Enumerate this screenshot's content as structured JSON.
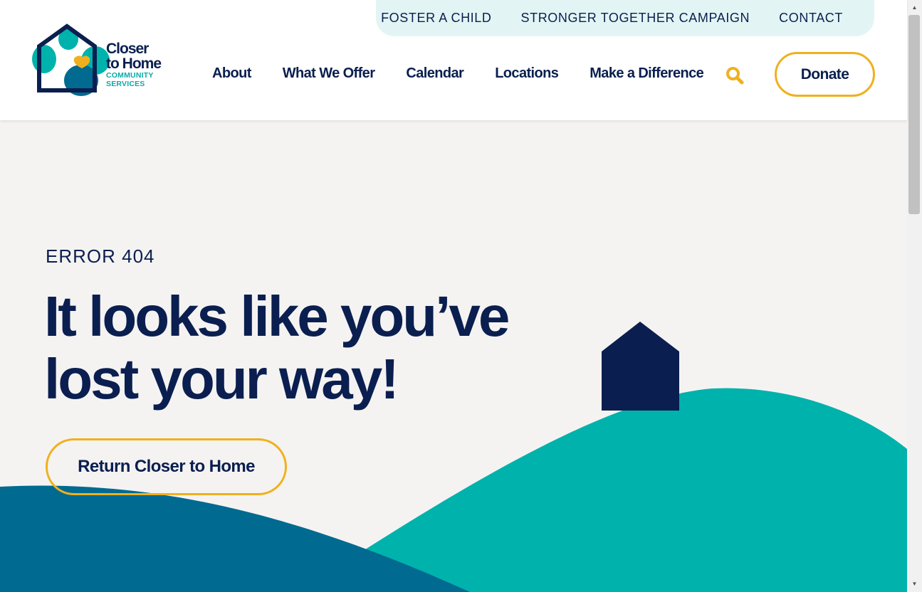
{
  "brand": {
    "logo_line1": "Closer",
    "logo_line2": "to Home",
    "logo_line3": "COMMUNITY",
    "logo_line4": "SERVICES",
    "colors": {
      "navy": "#0a1f4f",
      "teal": "#00b2ac",
      "blue": "#006a91",
      "yellow": "#f0b01e",
      "hero_bg": "#f5f3f2",
      "utility_bg": "#e2f5f4"
    }
  },
  "utility_nav": [
    {
      "label": "FOSTER A CHILD"
    },
    {
      "label": "STRONGER TOGETHER CAMPAIGN"
    },
    {
      "label": "CONTACT"
    }
  ],
  "main_nav": [
    {
      "label": "About"
    },
    {
      "label": "What We Offer"
    },
    {
      "label": "Calendar"
    },
    {
      "label": "Locations"
    },
    {
      "label": "Make a Difference"
    }
  ],
  "header": {
    "search_icon": "search-icon",
    "donate_label": "Donate"
  },
  "hero": {
    "error_code": "ERROR 404",
    "headline": "It looks like you’ve lost your way!",
    "return_label": "Return Closer to Home"
  }
}
